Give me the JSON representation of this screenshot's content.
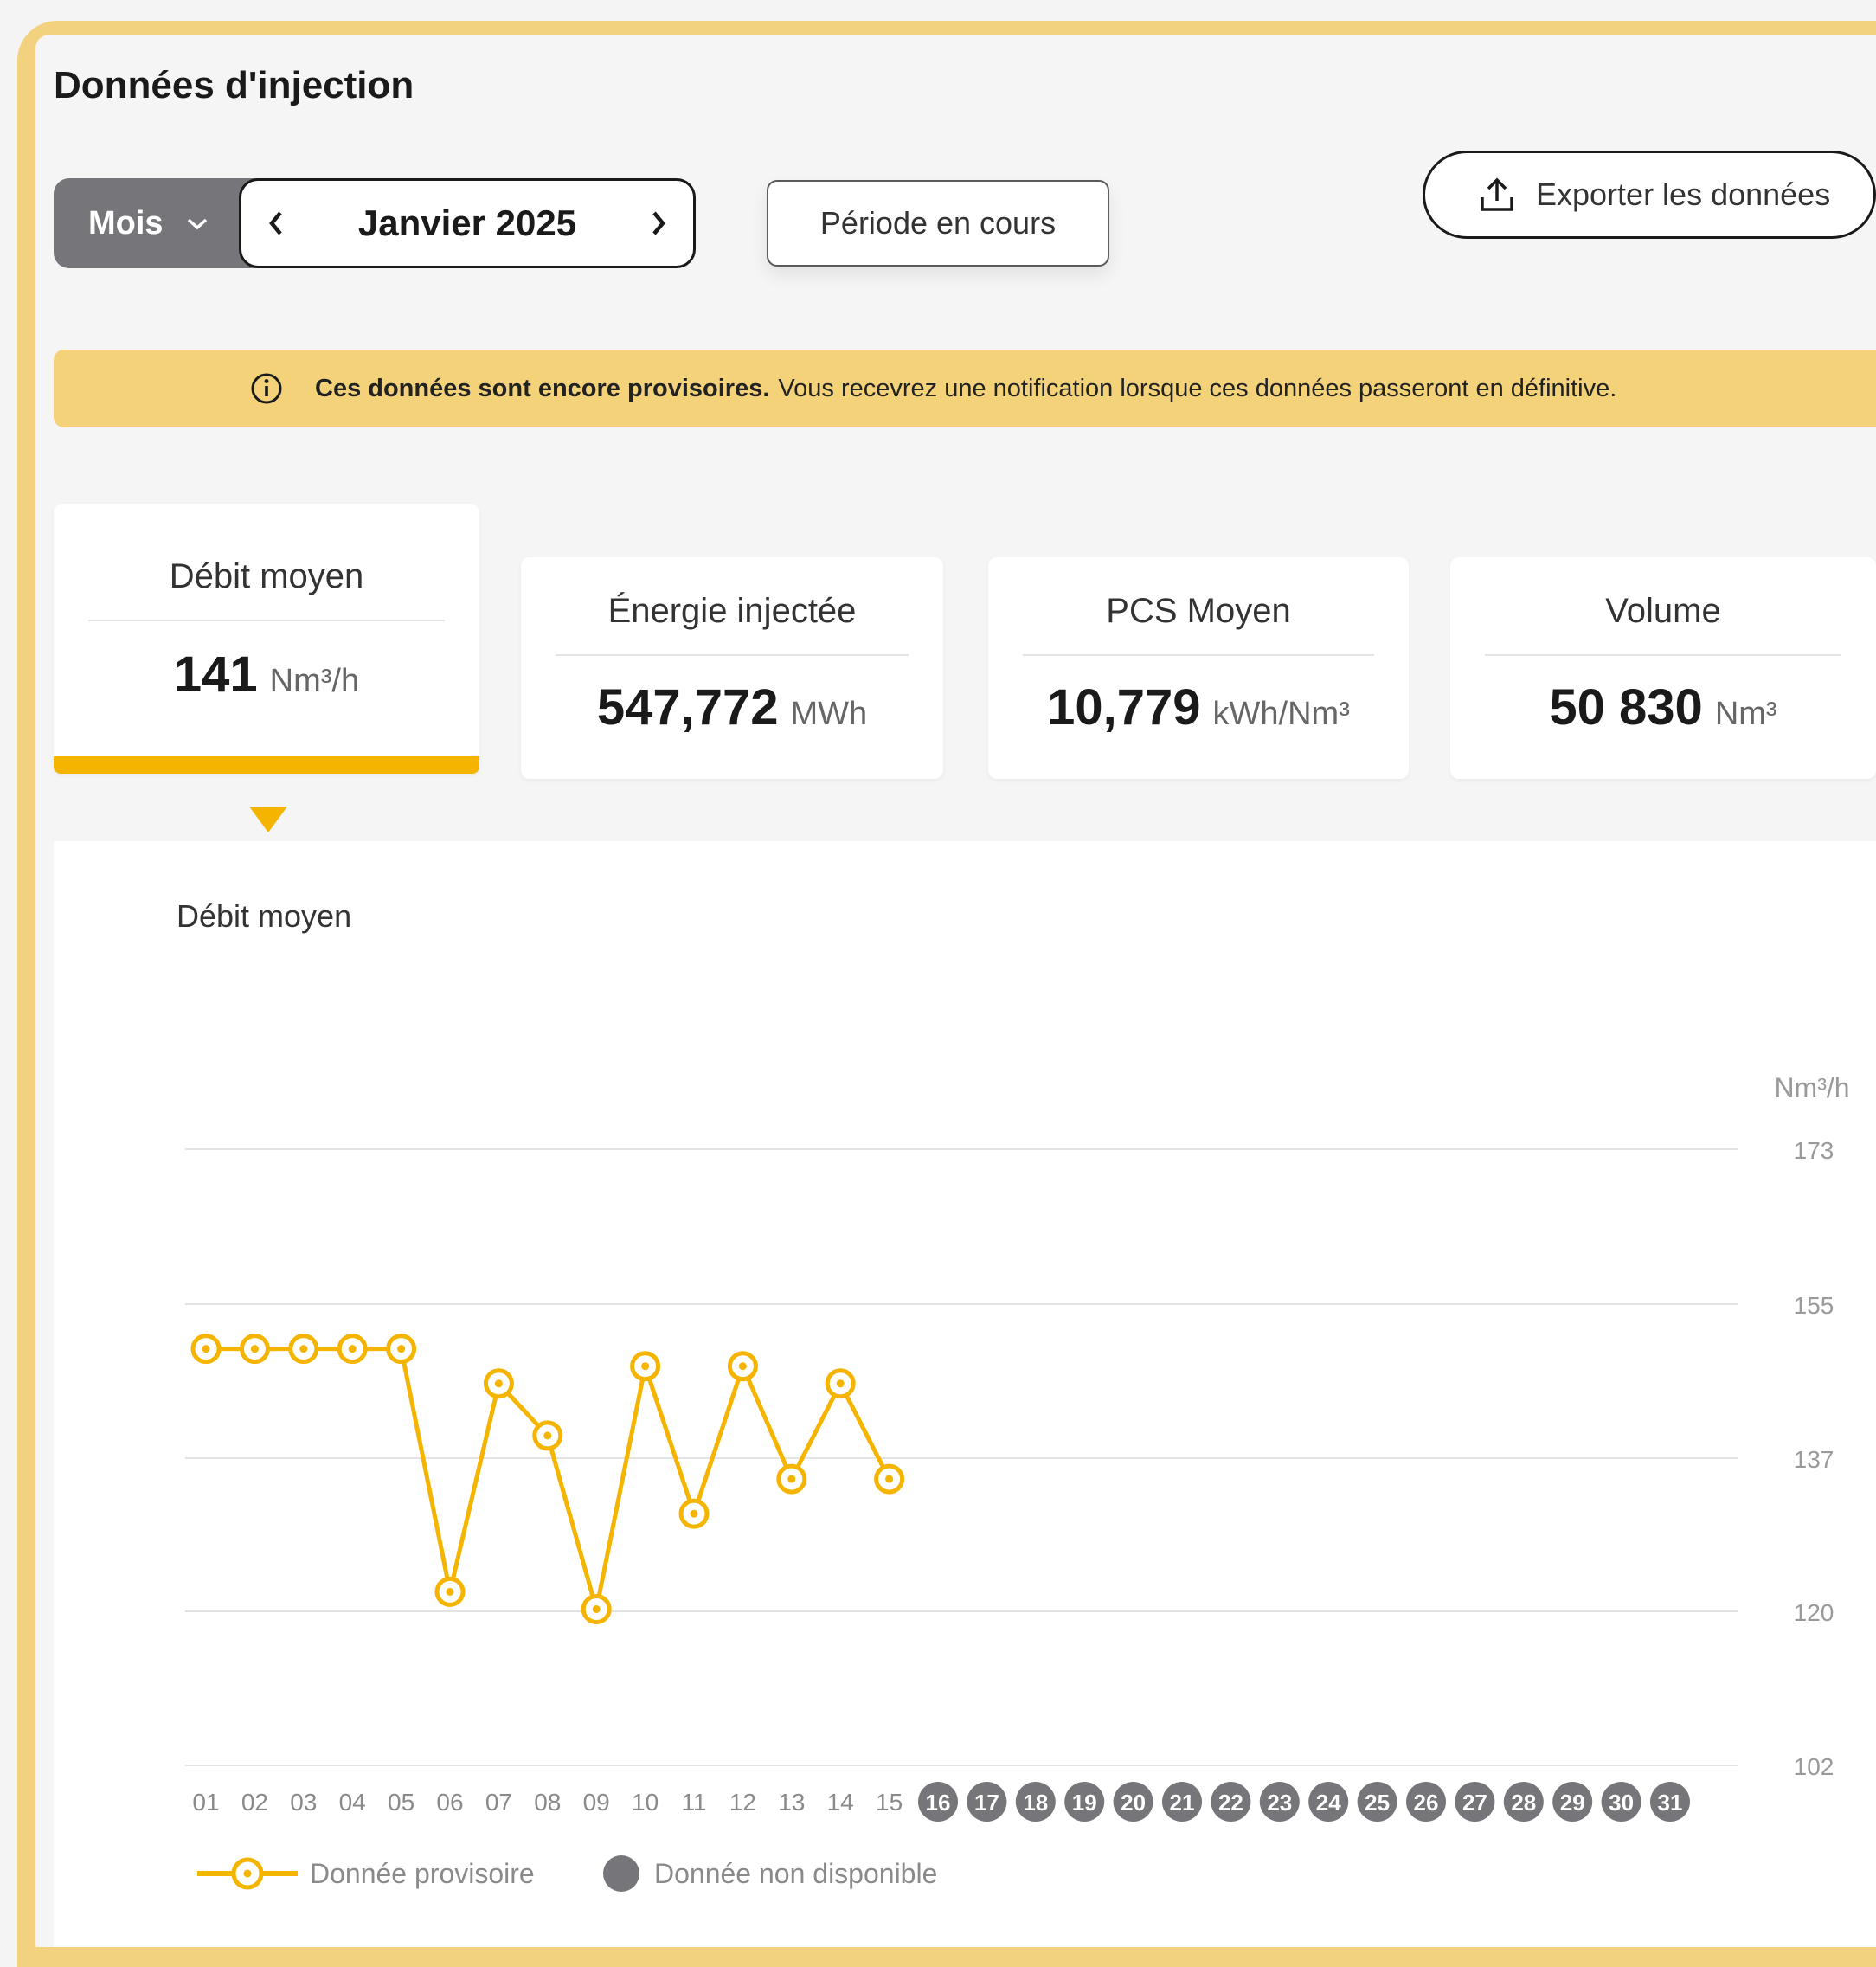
{
  "page": {
    "title": "Données d'injection"
  },
  "controls": {
    "mode": "Mois",
    "month": "Janvier 2025",
    "current_period": "Période en cours",
    "export": "Exporter les données"
  },
  "banner": {
    "bold": "Ces données sont encore provisoires.",
    "text": "Vous recevrez une notification lorsque ces données passeront en définitive."
  },
  "kpis": [
    {
      "label": "Débit moyen",
      "value": "141",
      "unit": "Nm³/h"
    },
    {
      "label": "Énergie injectée",
      "value": "547,772",
      "unit": "MWh"
    },
    {
      "label": "PCS Moyen",
      "value": "10,779",
      "unit": "kWh/Nm³"
    },
    {
      "label": "Volume",
      "value": "50 830",
      "unit": "Nm³"
    }
  ],
  "colors": {
    "accent": "#f4b400",
    "unavailable": "#76767a",
    "banner": "#f3d27a"
  },
  "chart_data": {
    "type": "line",
    "title": "Débit moyen",
    "ylabel": "Nm³/h",
    "yticks": [
      "173",
      "155",
      "137",
      "120",
      "102"
    ],
    "ylim": [
      102,
      173
    ],
    "categories": [
      "01",
      "02",
      "03",
      "04",
      "05",
      "06",
      "07",
      "08",
      "09",
      "10",
      "11",
      "12",
      "13",
      "14",
      "15",
      "16",
      "17",
      "18",
      "19",
      "20",
      "21",
      "22",
      "23",
      "24",
      "25",
      "26",
      "27",
      "28",
      "29",
      "30",
      "31"
    ],
    "series": [
      {
        "name": "Donnée provisoire",
        "values": [
          150,
          150,
          150,
          150,
          150,
          122,
          146,
          140,
          120,
          148,
          131,
          148,
          135,
          146,
          135,
          null,
          null,
          null,
          null,
          null,
          null,
          null,
          null,
          null,
          null,
          null,
          null,
          null,
          null,
          null,
          null
        ]
      }
    ],
    "unavailable_days": [
      "16",
      "17",
      "18",
      "19",
      "20",
      "21",
      "22",
      "23",
      "24",
      "25",
      "26",
      "27",
      "28",
      "29",
      "30",
      "31"
    ],
    "legend": [
      {
        "label": "Donnée provisoire",
        "kind": "provisional"
      },
      {
        "label": "Donnée non disponible",
        "kind": "unavailable"
      }
    ],
    "grid": true,
    "legend_position": "bottom-left"
  }
}
